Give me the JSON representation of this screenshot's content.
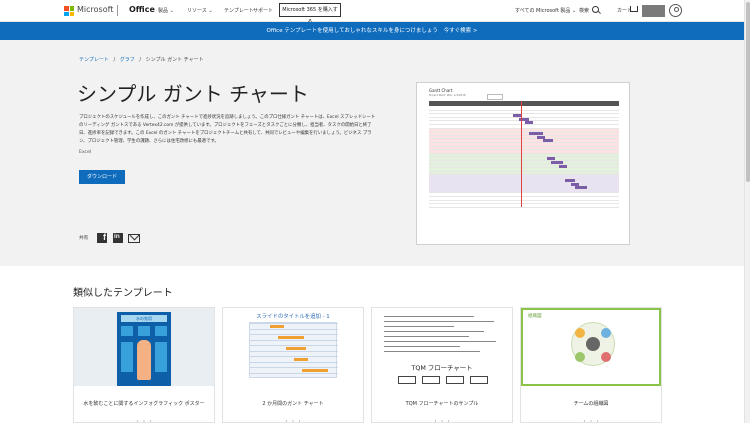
{
  "header": {
    "brand": "Microsoft",
    "office": "Office",
    "nav": [
      "製品",
      "リソース",
      "テンプレート",
      "サポート"
    ],
    "buy_button": "Microsoft 365 を購入する",
    "all_ms_products": "すべての Microsoft 製品",
    "search_label": "検索",
    "cart_label": "カート",
    "logo_colors": [
      "#f25022",
      "#7fba00",
      "#00a4ef",
      "#ffb900"
    ]
  },
  "banner": {
    "text": "Office テンプレートを使用しておしゃれなスキルを身につけましょう",
    "link": "今すぐ検索 >",
    "color": "#0f6cbd"
  },
  "breadcrumb": {
    "items": [
      "テンプレート",
      "グラフ",
      "シンプル ガント チャート"
    ],
    "separator": "/"
  },
  "hero": {
    "title": "シンプル ガント チャート",
    "description": "プロジェクトのスケジュールを作成し、このガント チャートで進捗状況を追跡しましょう。このプロ仕様ガント チャートは、Excel スプレッドシートのリーディング ガントスである Vertex42.com が提供しています。プロジェクトをフェーズとタスクごとに分類し、担当者、タスクの開始日と終了日、進捗率を記録できます。この Excel のガント チャートをプロジェクトチームと共有して、共同でレビューや編集を行いましょう。ビジネス プラン、プロジェクト管理、学生の課題、さらには住宅改修にも最適です。",
    "app": "Excel",
    "download_button": "ダウンロード",
    "share_label": "共有"
  },
  "preview": {
    "title": "Gantt Chart",
    "subtitle": "Project Start: Mon, 1/1/2018"
  },
  "similar": {
    "title": "類似したテンプレート",
    "templates": [
      {
        "name": "水を飲むことに関するインフォグラフィック ポスター",
        "thumb_text": "水の効用"
      },
      {
        "name": "2 か月間のガント チャート",
        "thumb_text": "スライドのタイトルを追加 - 1"
      },
      {
        "name": "TQM フローチャートのサンプル",
        "thumb_text": "TQM フローチャート"
      },
      {
        "name": "チームの組織図",
        "thumb_text": "組織図"
      }
    ],
    "ellipsis": "・ ・ ・"
  }
}
